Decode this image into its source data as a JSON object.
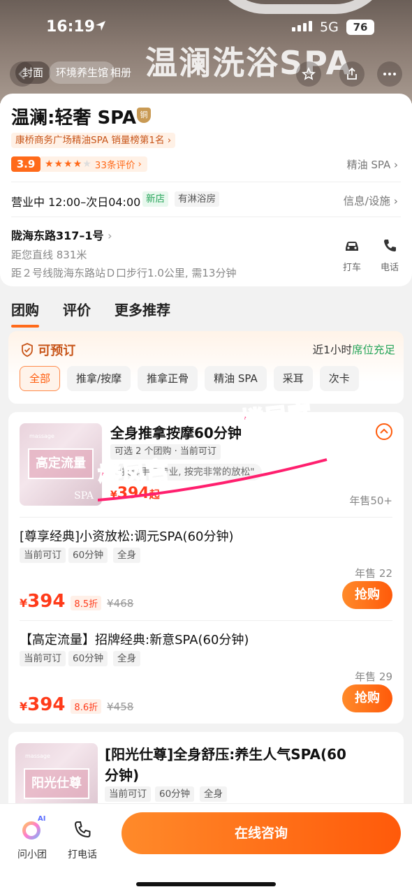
{
  "status": {
    "time": "16:19",
    "network": "5G",
    "battery": "76"
  },
  "hero": {
    "brand": "温澜洗浴SPA",
    "chip_left": "封面",
    "chip_mid": "环境养生馆",
    "chip_right": "相册"
  },
  "shop": {
    "title": "温澜:轻奢 SPA",
    "medal": "铜",
    "rank": "康桥商务广场精油SPA 销量榜第1名",
    "score": "3.9",
    "stars": "★★★★",
    "star_off": "★",
    "reviews": "33条评价",
    "category": "精油 SPA",
    "hours": "营业中 12:00–次日04:00",
    "tag_new": "新店",
    "tag_shower": "有淋浴房",
    "info_link": "信息/设施",
    "address": "陇海东路317–1号",
    "distance": "距您直线 831米",
    "transit": "距２号线陇海东路站Ｄ口步行1.0公里, 需13分钟",
    "action_taxi": "打车",
    "action_phone": "电话"
  },
  "tabs": [
    "团购",
    "评价",
    "更多推荐"
  ],
  "booking": {
    "title": "可预订",
    "right_prefix": "近1小时",
    "right_status": "席位充足",
    "filters": [
      "全部",
      "推拿/按摩",
      "推拿正骨",
      "精油 SPA",
      "采耳",
      "次卡"
    ]
  },
  "product": {
    "thumb_title": "高定流量",
    "thumb_spa": "SPA",
    "thumb_mini": "massage",
    "title": "全身推拿按摩60分钟",
    "sub": "可选 2 个团购 · 当前可订",
    "quote": "\"技师手法专业, 按完非常的放松\"",
    "price_prefix": "¥",
    "price": "394",
    "price_suffix": "起",
    "year_sale": "年售50+",
    "deals": [
      {
        "title": "[尊享经典]小资放松:调元SPA(60分钟)",
        "tags": [
          "当前可订",
          "60分钟",
          "全身"
        ],
        "year_sale": "年售 22",
        "price": "394",
        "discount": "8.5折",
        "original": "¥468",
        "buy": "抢购"
      },
      {
        "title": "【高定流量】招牌经典:新意SPA(60分钟)",
        "tags": [
          "当前可订",
          "60分钟",
          "全身"
        ],
        "year_sale": "年售 29",
        "price": "394",
        "discount": "8.6折",
        "original": "¥458",
        "buy": "抢购"
      }
    ]
  },
  "product2": {
    "thumb_title": "阳光仕尊",
    "thumb_mini": "massage",
    "title_line1": "[阳光仕尊]全身舒压:养生人气SPA(60",
    "title_line2": "分钟)",
    "tags": [
      "当前可订",
      "60分钟",
      "全身"
    ]
  },
  "watermark": {
    "text": "楼凤宫"
  },
  "bottom": {
    "assistant": "问小团",
    "call": "打电话",
    "consult": "在线咨询",
    "ai_badge": "AI"
  },
  "colors": {
    "accent": "#ff5a0a",
    "price": "#ff3b1a",
    "green": "#27a55a",
    "watermark": "#ff1f6e"
  }
}
